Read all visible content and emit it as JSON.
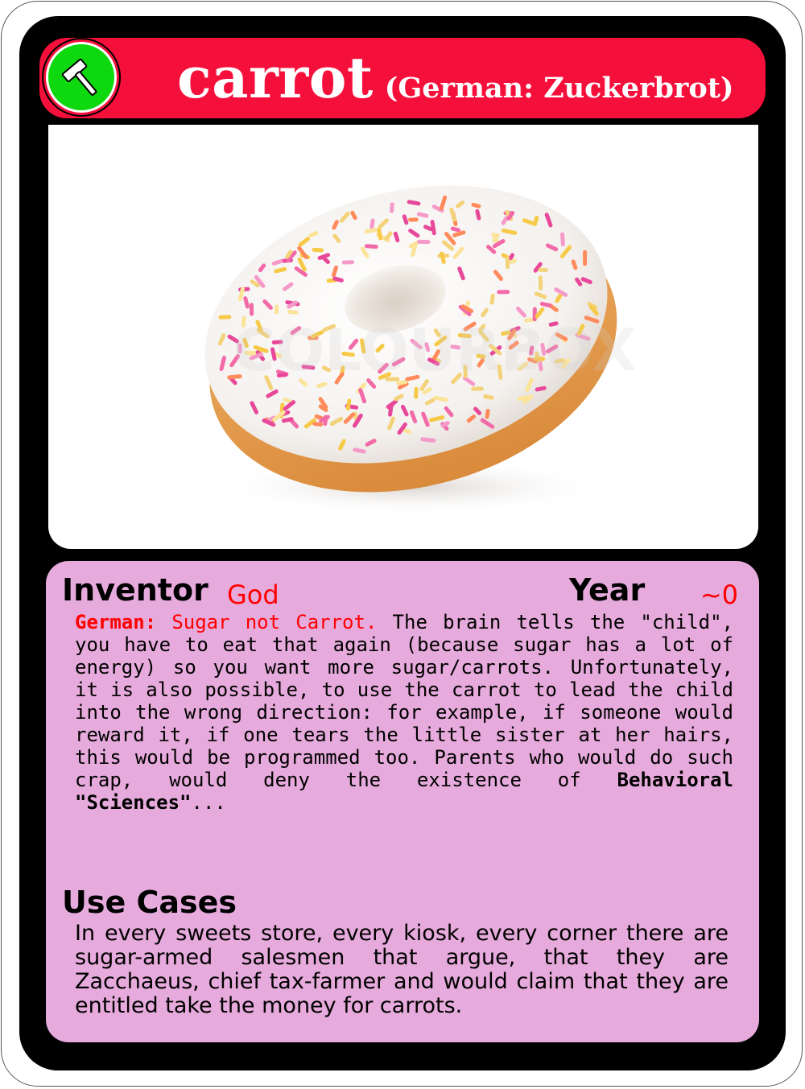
{
  "card": {
    "title": "carrot",
    "subtitle": "(German: Zuckerbrot)",
    "badge_icon": "hammer-icon",
    "colors": {
      "title_bar": "#f5103b",
      "badge": "#0ed90e",
      "info_panel": "#e6abdc",
      "frame": "#000000",
      "highlight": "#ff0000"
    }
  },
  "image": {
    "icon": "donut-image",
    "watermark": "COLOURBOX"
  },
  "info": {
    "inventor_label": "Inventor",
    "inventor_value": "God",
    "year_label": "Year",
    "year_value": "~0",
    "description_prefix": "German:",
    "description_red": " Sugar not Carrot.",
    "description_body": " The brain tells the \"child\", you have to eat that again (because sugar has a lot of energy) so you want more sugar/carrots. Unfortunately, it is also possible, to use the carrot to lead the child into the wrong direction: for example, if someone would reward it, if one tears the little sister at her hairs, this would be programmed too. Parents who would do such crap, would deny the existence of ",
    "description_bold": "Behavioral \"Sciences\"",
    "description_suffix": "..."
  },
  "use_cases": {
    "title": "Use Cases",
    "text": "In every sweets store, every kiosk, every corner there are sugar-armed salesmen that argue, that they are Zacchaeus, chief tax-farmer and would claim that they are entitled take the money for carrots."
  }
}
